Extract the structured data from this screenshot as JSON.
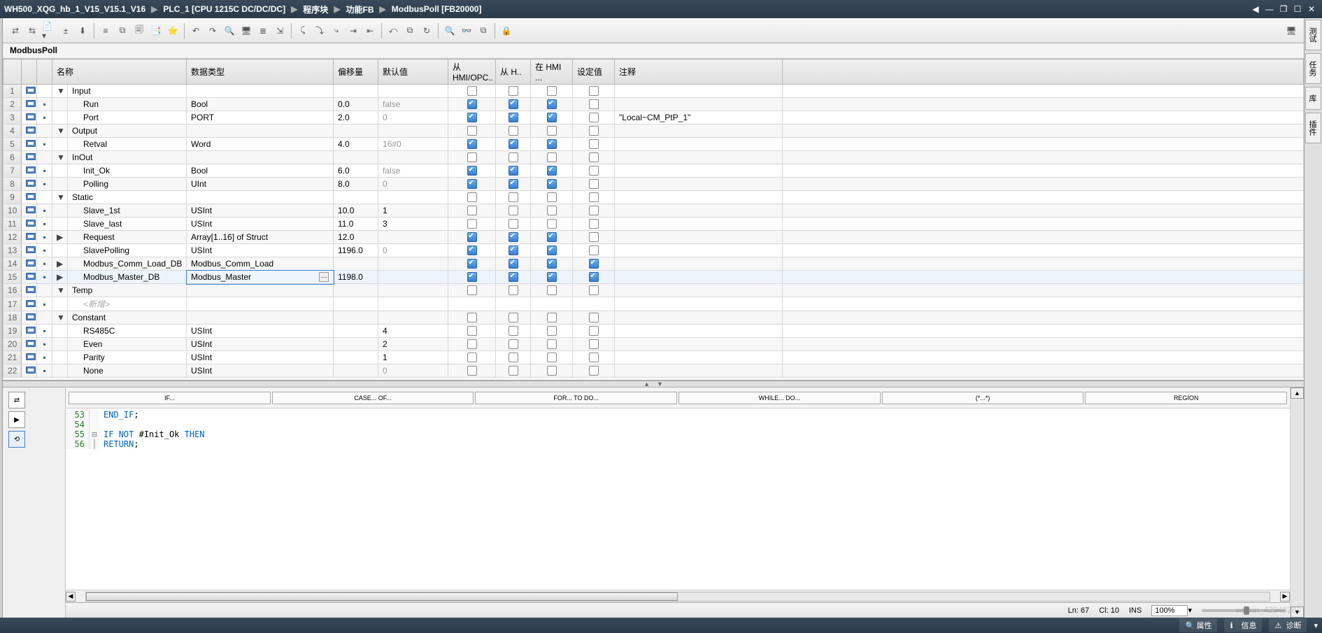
{
  "breadcrumb": [
    "WH500_XQG_hb_1_V15_V15.1_V16",
    "PLC_1 [CPU 1215C DC/DC/DC]",
    "程序块",
    "功能FB",
    "ModbusPoll [FB20000]"
  ],
  "window_buttons": {
    "min": "—",
    "restore": "❐",
    "max": "☐",
    "close": "✕",
    "left": "◀"
  },
  "toolbar_icons": [
    "⇄",
    "⇆",
    "📄▾",
    "±",
    "⬇",
    "│",
    "≡",
    "⧉",
    "🗐",
    "📑",
    "⭐",
    "│",
    "↶",
    "↷",
    "🔍",
    "🖥",
    "≣",
    "⇲",
    "│",
    "⤹",
    "⤵",
    "⤷",
    "⇥",
    "⇤",
    "│",
    "⤺",
    "⧉",
    "↻",
    "│",
    "🔍",
    "👓",
    "⧉",
    "│",
    "🔒"
  ],
  "right_toolbar_icon": "🖥",
  "block_name": "ModbusPoll",
  "columns": {
    "name": "名称",
    "type": "数据类型",
    "offset": "偏移量",
    "default": "默认值",
    "hmi_opc": "从 HMI/OPC..",
    "from_h": "从 H..",
    "at_hmi": "在 HMI ...",
    "setpoint": "设定值",
    "comment": "注释"
  },
  "rows": [
    {
      "n": 1,
      "section": true,
      "exp": "▼",
      "name": "Input"
    },
    {
      "n": 2,
      "name": "Run",
      "type": "Bool",
      "off": "0.0",
      "def": "false",
      "c1": true,
      "c2": true,
      "c3": true,
      "c4": false
    },
    {
      "n": 3,
      "name": "Port",
      "type": "PORT",
      "off": "2.0",
      "def": "0",
      "c1": true,
      "c2": true,
      "c3": true,
      "c4": false,
      "comment": "\"Local~CM_PtP_1\""
    },
    {
      "n": 4,
      "section": true,
      "exp": "▼",
      "name": "Output"
    },
    {
      "n": 5,
      "name": "Retval",
      "type": "Word",
      "off": "4.0",
      "def": "16#0",
      "c1": true,
      "c2": true,
      "c3": true,
      "c4": false
    },
    {
      "n": 6,
      "section": true,
      "exp": "▼",
      "name": "InOut"
    },
    {
      "n": 7,
      "name": "Init_Ok",
      "type": "Bool",
      "off": "6.0",
      "def": "false",
      "c1": true,
      "c2": true,
      "c3": true,
      "c4": false
    },
    {
      "n": 8,
      "name": "Polling",
      "type": "UInt",
      "off": "8.0",
      "def": "0",
      "c1": true,
      "c2": true,
      "c3": true,
      "c4": false
    },
    {
      "n": 9,
      "section": true,
      "exp": "▼",
      "name": "Static"
    },
    {
      "n": 10,
      "name": "Slave_1st",
      "type": "USInt",
      "off": "10.0",
      "def": "1",
      "c1": false,
      "c2": false,
      "c3": false,
      "c4": false
    },
    {
      "n": 11,
      "name": "Slave_last",
      "type": "USInt",
      "off": "11.0",
      "def": "3",
      "c1": false,
      "c2": false,
      "c3": false,
      "c4": false
    },
    {
      "n": 12,
      "exp": "▶",
      "name": "Request",
      "type": "Array[1..16] of Struct",
      "off": "12.0",
      "c1": true,
      "c2": true,
      "c3": true,
      "c4": false
    },
    {
      "n": 13,
      "name": "SlavePolling",
      "type": "USInt",
      "off": "1196.0",
      "def": "0",
      "c1": true,
      "c2": true,
      "c3": true,
      "c4": false
    },
    {
      "n": 14,
      "exp": "▶",
      "name": "Modbus_Comm_Load_DB",
      "type": "Modbus_Comm_Load",
      "c1": true,
      "c2": true,
      "c3": true,
      "c4": true
    },
    {
      "n": 15,
      "exp": "▶",
      "name": "Modbus_Master_DB",
      "type": "Modbus_Master",
      "typebtn": true,
      "off": "1198.0",
      "c1": true,
      "c2": true,
      "c3": true,
      "c4": true,
      "selected": true
    },
    {
      "n": 16,
      "section": true,
      "exp": "▼",
      "name": "Temp"
    },
    {
      "n": 17,
      "new": true,
      "name": "<新增>"
    },
    {
      "n": 18,
      "section": true,
      "exp": "▼",
      "name": "Constant"
    },
    {
      "n": 19,
      "name": "RS485C",
      "type": "USInt",
      "def": "4",
      "c1": false,
      "c2": false,
      "c3": false,
      "c4": false
    },
    {
      "n": 20,
      "name": "Even",
      "type": "USInt",
      "def": "2",
      "c1": false,
      "c2": false,
      "c3": false,
      "c4": false
    },
    {
      "n": 21,
      "name": "Parity",
      "type": "USInt",
      "def": "1",
      "c1": false,
      "c2": false,
      "c3": false,
      "c4": false
    },
    {
      "n": 22,
      "name": "None",
      "type": "USInt",
      "def": "0",
      "c1": false,
      "c2": false,
      "c3": false,
      "c4": false
    }
  ],
  "snippets": [
    "IF...",
    "CASE... OF...",
    "FOR... TO DO...",
    "WHILE... DO...",
    "(*...*)",
    "REGION"
  ],
  "code": [
    {
      "ln": 53,
      "g": "",
      "t": "END_IF;",
      "kw": [
        "END_IF"
      ]
    },
    {
      "ln": 54,
      "g": "",
      "t": ""
    },
    {
      "ln": 55,
      "g": "⊟",
      "t": "IF NOT #Init_Ok THEN",
      "kw": [
        "IF",
        "NOT",
        "THEN"
      ]
    },
    {
      "ln": 56,
      "g": "│",
      "t": "    RETURN;",
      "kw": [
        "RETURN"
      ]
    }
  ],
  "code_status": {
    "ln": "Ln: 67",
    "col": "Cl: 10",
    "ins": "INS",
    "zoom": "100%"
  },
  "bottom": {
    "props": "属性",
    "info": "信息",
    "diag": "诊断"
  },
  "right_tabs": [
    "测试",
    "任务",
    "库",
    "插件"
  ],
  "watermark": "weixin_42948283",
  "splitter_glyphs": {
    "up": "▲",
    "down": "▼"
  }
}
